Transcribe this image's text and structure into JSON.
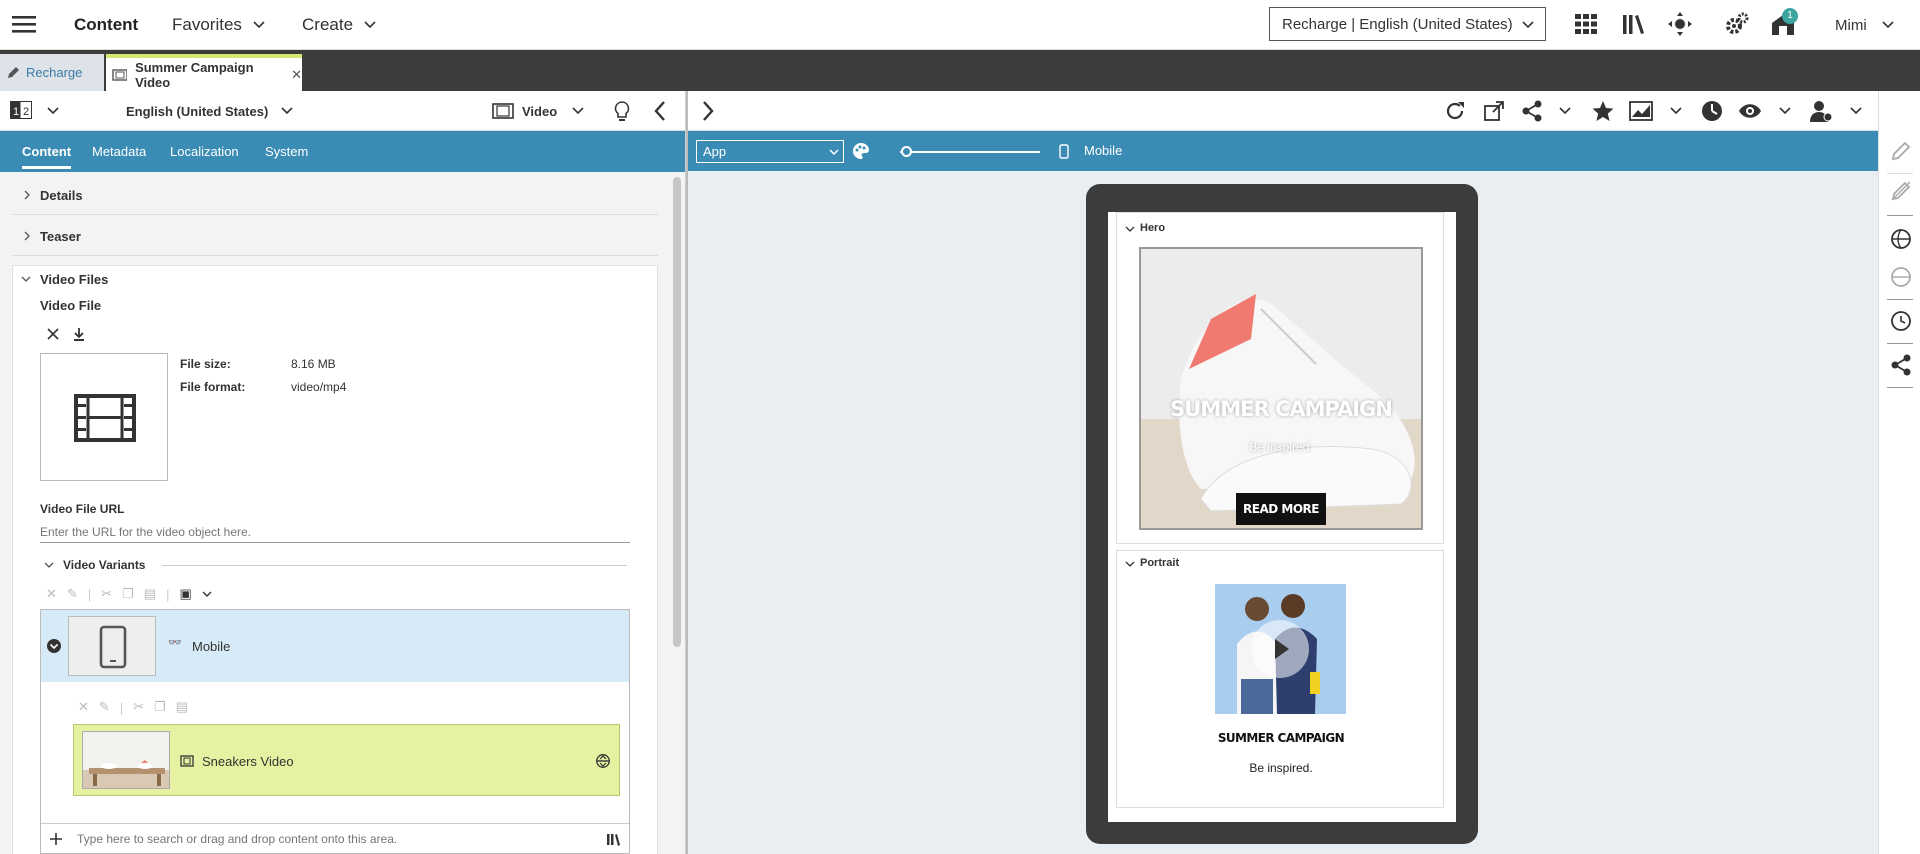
{
  "topbar": {
    "title": "Content",
    "favorites": "Favorites",
    "create": "Create",
    "site_select": "Recharge | English (United States)",
    "notification_count": "1",
    "user": "Mimi"
  },
  "tabs": [
    {
      "label": "Recharge"
    },
    {
      "label": "Summer Campaign Video"
    }
  ],
  "left": {
    "locale": "English (United States)",
    "doc_type": "Video",
    "tabs": [
      "Content",
      "Metadata",
      "Localization",
      "System"
    ],
    "sections": {
      "details": "Details",
      "teaser": "Teaser",
      "video_files": "Video Files"
    },
    "video_file": {
      "label": "Video File",
      "size_label": "File size:",
      "size_value": "8.16 MB",
      "format_label": "File format:",
      "format_value": "video/mp4"
    },
    "video_url": {
      "label": "Video File URL",
      "placeholder": "Enter the URL for the video object here."
    },
    "variants": {
      "title": "Video Variants",
      "mobile_label": "Mobile",
      "sneakers_label": "Sneakers Video",
      "search_placeholder": "Type here to search or drag and drop content onto this area."
    }
  },
  "right": {
    "preview_select": "App",
    "device_label": "Mobile",
    "hero_label": "Hero",
    "hero_title": "SUMMER CAMPAIGN",
    "hero_sub": "Be inspired.",
    "hero_button": "READ MORE",
    "portrait_label": "Portrait",
    "portrait_title": "SUMMER CAMPAIGN",
    "portrait_sub": "Be inspired."
  },
  "colors": {
    "accent_blue": "#3a8cb5",
    "tab_active_green": "#d8e86e",
    "variant_green": "#e6f2a2",
    "selected_row": "#d6ebf7",
    "dark_bar": "#3c3c3c"
  }
}
